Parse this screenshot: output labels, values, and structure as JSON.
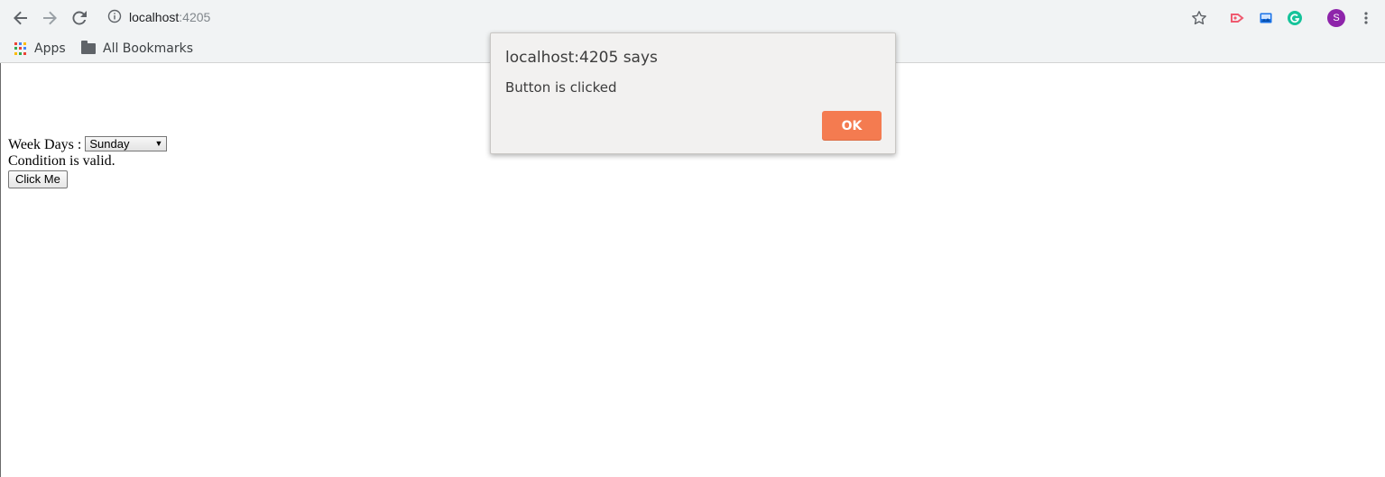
{
  "browser": {
    "url_host": "localhost",
    "url_port": ":4205",
    "profile_initial": "S",
    "profile_color": "#8e24aa",
    "icons": [
      "back-arrow-icon",
      "forward-arrow-icon",
      "reload-icon",
      "site-info-icon",
      "bookmark-star-icon",
      "extension-red-icon",
      "extension-image-icon",
      "grammarly-icon",
      "menu-dots-icon"
    ]
  },
  "bookmarks": {
    "apps_label": "Apps",
    "all_bookmarks_label": "All Bookmarks"
  },
  "page": {
    "weekdays_label": "Week Days : ",
    "weekdays_selected": "Sunday",
    "condition_text": "Condition is valid.",
    "button_label": "Click Me"
  },
  "dialog": {
    "title": "localhost:4205 says",
    "message": "Button is clicked",
    "ok_label": "OK",
    "ok_color": "#f47b50"
  }
}
